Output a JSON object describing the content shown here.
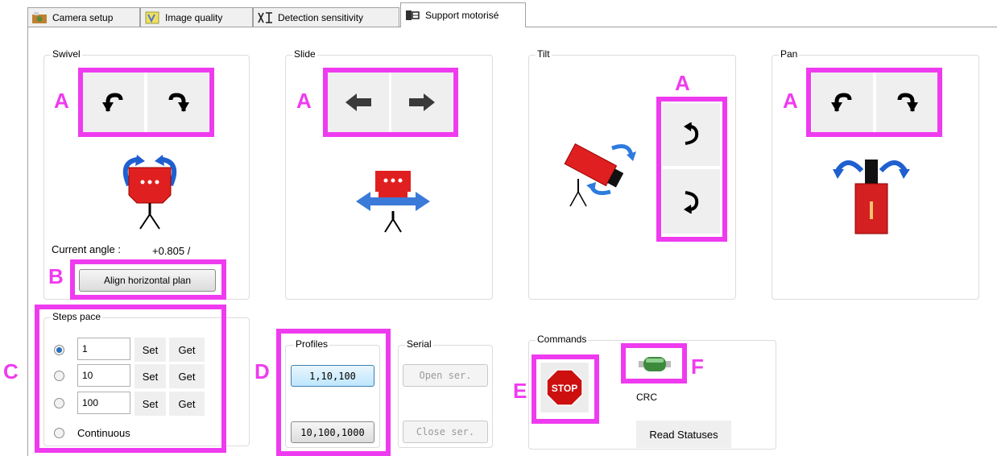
{
  "tabs": [
    {
      "label": "Camera setup",
      "icon": "camera-setup-icon"
    },
    {
      "label": "Image quality",
      "icon": "image-quality-icon"
    },
    {
      "label": "Detection sensitivity",
      "icon": "detection-sensitivity-icon"
    },
    {
      "label": "Support motorisé",
      "icon": "motorized-support-icon"
    }
  ],
  "groups": {
    "swivel": "Swivel",
    "slide": "Slide",
    "tilt": "Tilt",
    "pan": "Pan",
    "steps": "Steps pace",
    "profiles": "Profiles",
    "serial": "Serial",
    "commands": "Commands"
  },
  "swivel": {
    "angle_label": "Current angle :",
    "angle_value": "+0.805 /",
    "align_button": "Align horizontal plan"
  },
  "steps": {
    "rows": [
      {
        "value": "1",
        "set": "Set",
        "get": "Get",
        "selected": true
      },
      {
        "value": "10",
        "set": "Set",
        "get": "Get",
        "selected": false
      },
      {
        "value": "100",
        "set": "Set",
        "get": "Get",
        "selected": false
      }
    ],
    "continuous": "Continuous"
  },
  "profiles": {
    "first": "1,10,100",
    "second": "10,100,1000"
  },
  "serial": {
    "open": "Open ser.",
    "close": "Close ser."
  },
  "commands": {
    "stop": "STOP",
    "crc": "CRC",
    "read_statuses": "Read Statuses"
  },
  "annotations": {
    "A": "A",
    "B": "B",
    "C": "C",
    "D": "D",
    "E": "E",
    "F": "F"
  },
  "colors": {
    "highlight": "#ef3bef",
    "device_red": "#e02020",
    "arrow_blue": "#2060d0"
  }
}
